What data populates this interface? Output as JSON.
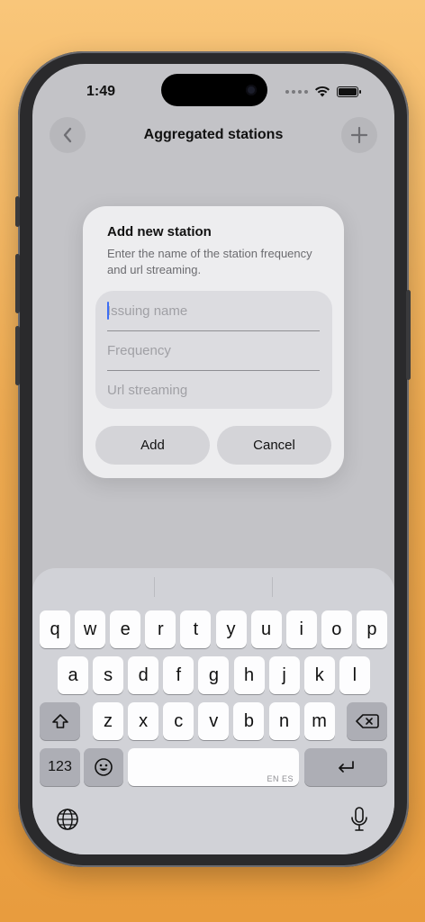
{
  "status_bar": {
    "time": "1:49"
  },
  "nav": {
    "title": "Aggregated stations",
    "back_icon": "chevron-left-icon",
    "add_icon": "plus-icon"
  },
  "dialog": {
    "title": "Add new station",
    "message": "Enter the name of the station frequency and url streaming.",
    "fields": {
      "name": {
        "value": "",
        "placeholder": "Issuing name"
      },
      "frequency": {
        "value": "",
        "placeholder": "Frequency"
      },
      "url": {
        "value": "",
        "placeholder": "Url streaming"
      }
    },
    "add_label": "Add",
    "cancel_label": "Cancel"
  },
  "keyboard": {
    "row1": [
      "q",
      "w",
      "e",
      "r",
      "t",
      "y",
      "u",
      "i",
      "o",
      "p"
    ],
    "row2": [
      "a",
      "s",
      "d",
      "f",
      "g",
      "h",
      "j",
      "k",
      "l"
    ],
    "row3": [
      "z",
      "x",
      "c",
      "v",
      "b",
      "n",
      "m"
    ],
    "numbers_label": "123",
    "space_hint": "EN ES",
    "colors": {
      "key": "#fdfdfe",
      "dark_key": "#adaeb5",
      "background": "#d1d2d7"
    }
  },
  "colors": {
    "accent": "#3d6ef5",
    "background_top": "#f9c67a",
    "background_bottom": "#e89c3e"
  }
}
